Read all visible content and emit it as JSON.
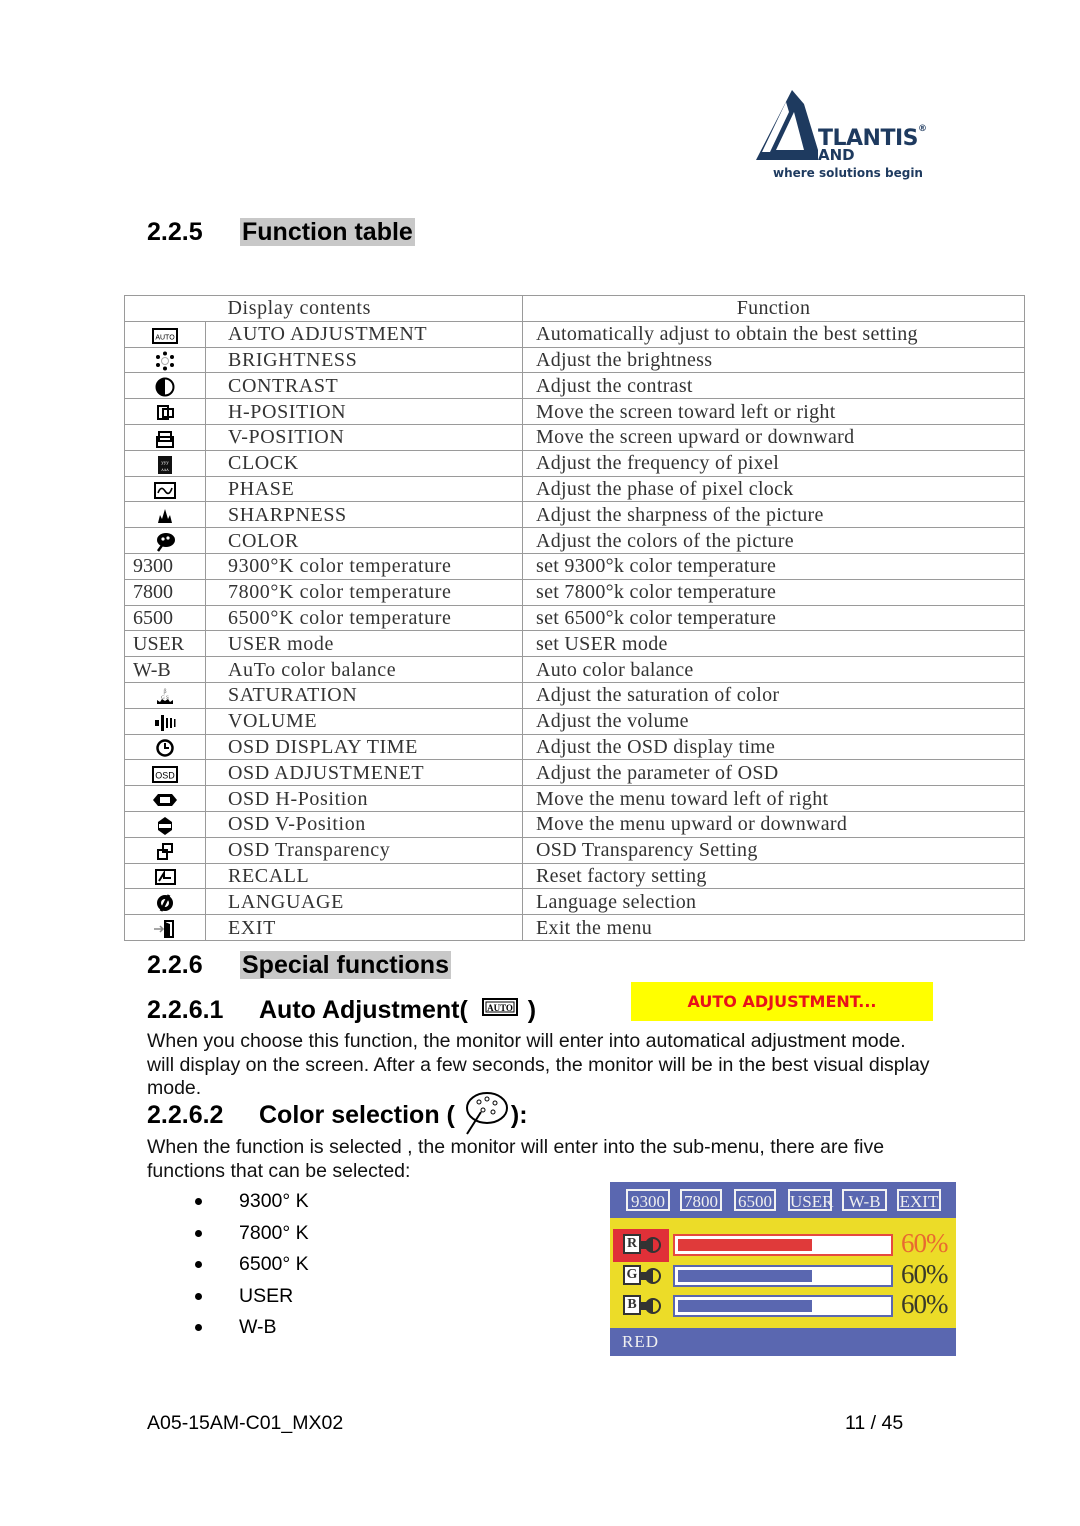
{
  "logo": {
    "brand": "TLANTIS",
    "registered": "®",
    "sub": "AND",
    "tagline": "where solutions begin",
    "color": "#1e3a5f"
  },
  "section_function_table": {
    "number": "2.2.5",
    "title": "Function table"
  },
  "table": {
    "headers": {
      "display": "Display contents",
      "function": "Function"
    },
    "rows": [
      {
        "icon": "auto-icon",
        "icon_text": "",
        "display": "AUTO ADJUSTMENT",
        "function": "Automatically adjust to obtain the best setting"
      },
      {
        "icon": "brightness-icon",
        "icon_text": "",
        "display": "BRIGHTNESS",
        "function": "Adjust the brightness"
      },
      {
        "icon": "contrast-icon",
        "icon_text": "",
        "display": "CONTRAST",
        "function": "Adjust the contrast"
      },
      {
        "icon": "h-position-icon",
        "icon_text": "",
        "display": "H-POSITION",
        "function": "Move the screen toward left or right"
      },
      {
        "icon": "v-position-icon",
        "icon_text": "",
        "display": "V-POSITION",
        "function": "Move the screen upward or downward"
      },
      {
        "icon": "clock-icon",
        "icon_text": "",
        "display": "CLOCK",
        "function": "Adjust the frequency of pixel"
      },
      {
        "icon": "phase-icon",
        "icon_text": "",
        "display": "PHASE",
        "function": "Adjust the phase of pixel clock"
      },
      {
        "icon": "sharpness-icon",
        "icon_text": "",
        "display": "SHARPNESS",
        "function": "Adjust the sharpness of the picture"
      },
      {
        "icon": "color-palette-icon",
        "icon_text": "",
        "display": "COLOR",
        "function": "Adjust the colors of the picture"
      },
      {
        "icon": "",
        "icon_text": "9300",
        "display": "9300°K color temperature",
        "function": "set 9300°k color temperature"
      },
      {
        "icon": "",
        "icon_text": "7800",
        "display": "7800°K color temperature",
        "function": "set 7800°k color temperature"
      },
      {
        "icon": "",
        "icon_text": "6500",
        "display": "6500°K color temperature",
        "function": "set 6500°k color temperature"
      },
      {
        "icon": "",
        "icon_text": "USER",
        "display": "USER mode",
        "function": "set USER mode"
      },
      {
        "icon": "",
        "icon_text": "W-B",
        "display": "AuTo color balance",
        "function": "Auto color balance"
      },
      {
        "icon": "saturation-icon",
        "icon_text": "",
        "display": "SATURATION",
        "function": "Adjust the saturation of color"
      },
      {
        "icon": "volume-icon",
        "icon_text": "",
        "display": "VOLUME",
        "function": "Adjust the volume"
      },
      {
        "icon": "osd-timer-icon",
        "icon_text": "",
        "display": "OSD DISPLAY TIME",
        "function": "Adjust the OSD display time"
      },
      {
        "icon": "osd-icon",
        "icon_text": "",
        "display": "OSD ADJUSTMENET",
        "function": "Adjust the parameter of OSD"
      },
      {
        "icon": "osd-h-position-icon",
        "icon_text": "",
        "display": "OSD H-Position",
        "function": "Move the menu toward left of right"
      },
      {
        "icon": "osd-v-position-icon",
        "icon_text": "",
        "display": "OSD V-Position",
        "function": "Move the menu upward or downward"
      },
      {
        "icon": "osd-transparency-icon",
        "icon_text": "",
        "display": "OSD Transparency",
        "function": "OSD Transparency Setting"
      },
      {
        "icon": "recall-icon",
        "icon_text": "",
        "display": "RECALL",
        "function": "Reset factory setting"
      },
      {
        "icon": "language-icon",
        "icon_text": "",
        "display": "LANGUAGE",
        "function": "Language selection"
      },
      {
        "icon": "exit-icon",
        "icon_text": "",
        "display": "EXIT",
        "function": "Exit the menu"
      }
    ]
  },
  "section_special": {
    "number": "2.2.6",
    "title": "Special functions"
  },
  "auto_adjustment": {
    "number": "2.2.6.1",
    "title_prefix": "Auto Adjustment(",
    "title_suffix": ")",
    "icon_label": "AUTO",
    "banner": "AUTO ADJUSTMENT...",
    "banner_bg": "#ffff00",
    "banner_color": "#e8121a",
    "paragraph": "When you choose this function, the monitor will enter into automatical adjustment mode.  will display on the screen. After a few seconds, the monitor will be in the best visual display mode."
  },
  "color_selection": {
    "number": "2.2.6.2",
    "title_prefix": "Color selection (",
    "title_suffix": "):",
    "paragraph": "When the function is selected , the monitor will  enter into the sub-menu, there are five functions that can be  selected:",
    "options": [
      "9300°  K",
      "7800°  K",
      "6500°  K",
      "USER",
      "W-B"
    ]
  },
  "osd_menu": {
    "tabs": [
      "9300",
      "7800",
      "6500",
      "USER",
      "W-B",
      "EXIT"
    ],
    "channels": [
      {
        "label": "R",
        "value_percent": 60,
        "display": "60%",
        "selected": true
      },
      {
        "label": "G",
        "value_percent": 60,
        "display": "60%",
        "selected": false
      },
      {
        "label": "B",
        "value_percent": 60,
        "display": "60%",
        "selected": false
      }
    ],
    "status": "RED",
    "colors": {
      "panel": "#5a67b0",
      "body": "#ecdc28",
      "highlight": "#e03038"
    }
  },
  "footer": {
    "doc_id": "A05-15AM-C01_MX02",
    "page": "11 / 45"
  }
}
